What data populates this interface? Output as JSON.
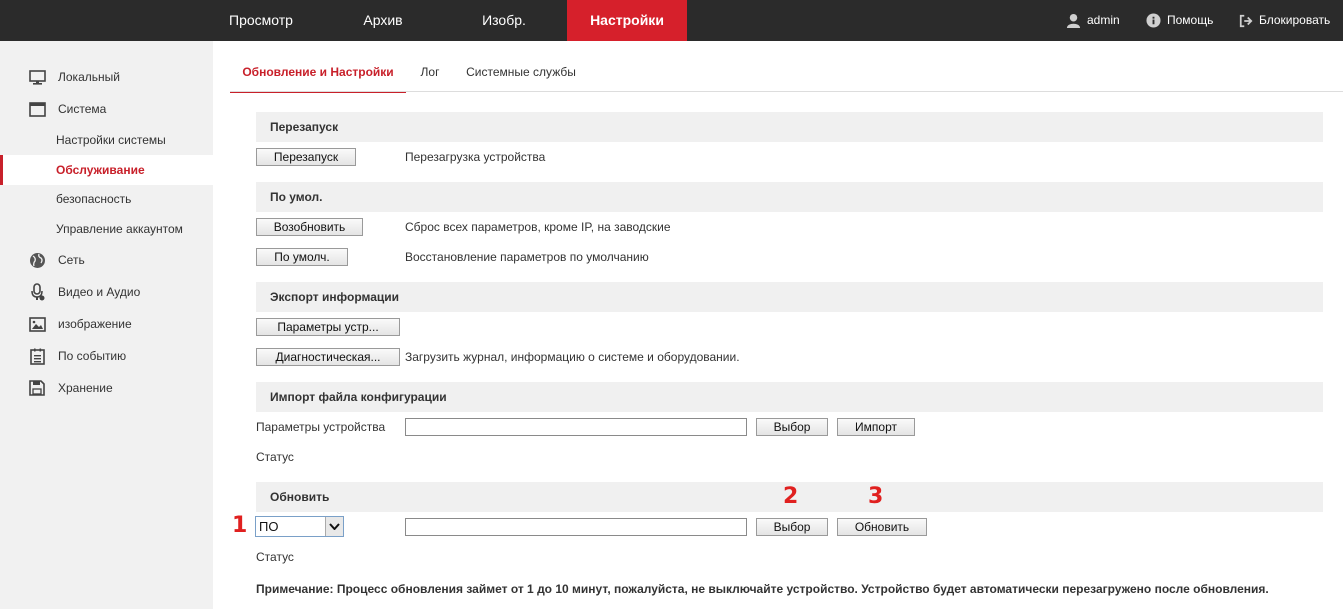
{
  "topnav": {
    "items": [
      {
        "label": "Просмотр",
        "active": false
      },
      {
        "label": "Архив",
        "active": false
      },
      {
        "label": "Изобр.",
        "active": false
      },
      {
        "label": "Настройки",
        "active": true
      }
    ],
    "user": "admin",
    "help": "Помощь",
    "logout": "Блокировать",
    "active_color": "#d6202b"
  },
  "sidebar": {
    "items": [
      {
        "label": "Локальный",
        "icon": "monitor-icon"
      },
      {
        "label": "Система",
        "icon": "window-icon"
      },
      {
        "label": "Настройки системы"
      },
      {
        "label": "Обслуживание",
        "active": true
      },
      {
        "label": "безопасность"
      },
      {
        "label": "Управление аккаунтом"
      },
      {
        "label": "Сеть",
        "icon": "globe-icon"
      },
      {
        "label": "Видео и Аудио",
        "icon": "microphone-icon"
      },
      {
        "label": "изображение",
        "icon": "image-icon"
      },
      {
        "label": "По событию",
        "icon": "event-list-icon"
      },
      {
        "label": "Хранение",
        "icon": "floppy-disk-icon"
      }
    ]
  },
  "tabs": [
    {
      "label": "Обновление и Настройки",
      "active": true
    },
    {
      "label": "Лог",
      "active": false
    },
    {
      "label": "Системные службы",
      "active": false
    }
  ],
  "sections": {
    "reboot": {
      "title": "Перезапуск",
      "button": "Перезапуск",
      "desc": "Перезагрузка устройства"
    },
    "default": {
      "title": "По умол.",
      "restore_button": "Возобновить",
      "restore_desc": "Сброс всех параметров, кроме IP, на заводские",
      "default_button": "По умолч.",
      "default_desc": "Восстановление параметров по умолчанию"
    },
    "export": {
      "title": "Экспорт информации",
      "params_button": "Параметры устр...",
      "diag_button": "Диагностическая...",
      "diag_desc": "Загрузить журнал, информацию о системе и оборудовании."
    },
    "import": {
      "title": "Импорт файла конфигурации",
      "label": "Параметры устройства",
      "file_value": "",
      "browse_button": "Выбор",
      "import_button": "Импорт",
      "status_label": "Статус"
    },
    "upgrade": {
      "title": "Обновить",
      "select_value": "ПО",
      "file_value": "",
      "browse_button": "Выбор",
      "upgrade_button": "Обновить",
      "status_label": "Статус",
      "note": "Примечание: Процесс обновления займет от 1 до 10 минут, пожалуйста, не выключайте устройство. Устройство будет автоматически перезагружено после обновления."
    }
  },
  "annotations": {
    "n1": "1",
    "n2": "2",
    "n3": "3",
    "color": "#e0201f"
  }
}
